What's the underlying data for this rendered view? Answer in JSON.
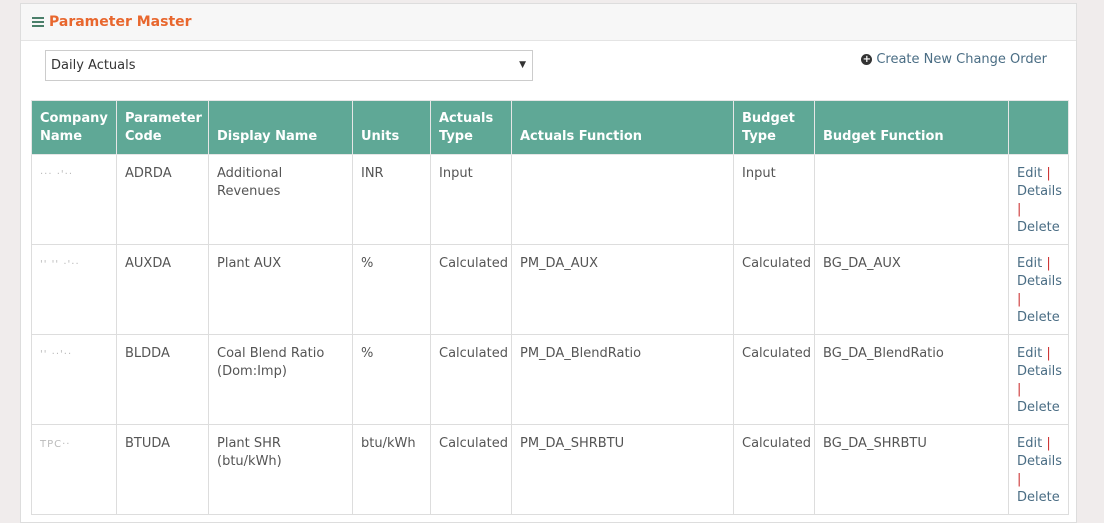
{
  "panel": {
    "title": "Parameter Master"
  },
  "select": {
    "value": "Daily Actuals"
  },
  "create_link": {
    "label": "Create New Change Order"
  },
  "table": {
    "headers": [
      "Company Name",
      "Parameter Code",
      "Display Name",
      "Units",
      "Actuals Type",
      "Actuals Function",
      "Budget Type",
      "Budget Function",
      ""
    ],
    "rows": [
      {
        "company": "··· ·'··",
        "code": "ADRDA",
        "display": "Additional Revenues",
        "units": "INR",
        "actuals_type": "Input",
        "actuals_function": "",
        "budget_type": "Input",
        "budget_function": ""
      },
      {
        "company": "'' '' ·'··",
        "code": "AUXDA",
        "display": "Plant AUX",
        "units": "%",
        "actuals_type": "Calculated",
        "actuals_function": "PM_DA_AUX",
        "budget_type": "Calculated",
        "budget_function": "BG_DA_AUX"
      },
      {
        "company": "'' ··'··",
        "code": "BLDDA",
        "display": "Coal Blend Ratio (Dom:Imp)",
        "units": "%",
        "actuals_type": "Calculated",
        "actuals_function": "PM_DA_BlendRatio",
        "budget_type": "Calculated",
        "budget_function": "BG_DA_BlendRatio"
      },
      {
        "company": "TPC··",
        "code": "BTUDA",
        "display": "Plant SHR (btu/kWh)",
        "units": "btu/kWh",
        "actuals_type": "Calculated",
        "actuals_function": "PM_DA_SHRBTU",
        "budget_type": "Calculated",
        "budget_function": "BG_DA_SHRBTU"
      }
    ],
    "actions": {
      "edit": "Edit",
      "details": "Details",
      "delete": "Delete",
      "separator": "|"
    }
  }
}
